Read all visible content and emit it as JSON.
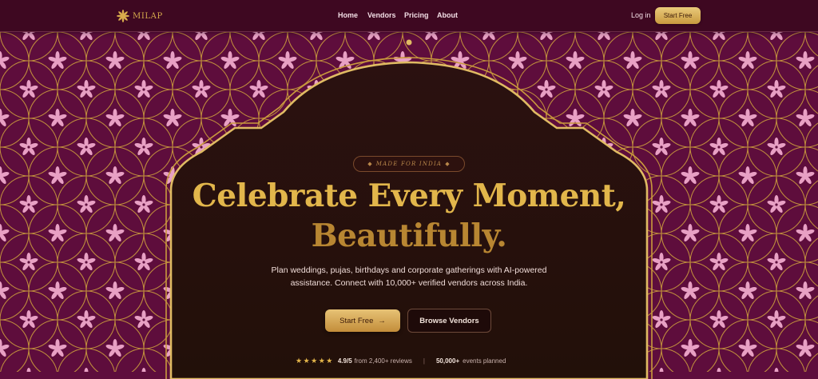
{
  "brand": {
    "name": "MILAP",
    "icon": "sparkle-icon"
  },
  "nav": {
    "links": [
      "Home",
      "Vendors",
      "Pricing",
      "About"
    ],
    "login": "Log in",
    "cta": "Start Free"
  },
  "hero": {
    "badge": "MADE FOR INDIA",
    "headline_line1": "Celebrate Every Moment,",
    "headline_line2": "Beautifully.",
    "subtext": "Plan weddings, pujas, birthdays and corporate gatherings with AI-powered assistance. Connect with 10,000+ verified vendors across India.",
    "primary_cta": "Start Free",
    "primary_cta_icon": "arrow-right-icon",
    "secondary_cta": "Browse Vendors"
  },
  "stats": {
    "stars": "★★★★★",
    "rating_value": "4.9/5",
    "rating_text": "from 2,400+ reviews",
    "separator": "|",
    "events_value": "50,000+",
    "events_text": "events planned"
  },
  "colors": {
    "background": "#5e0d3c",
    "gold": "#d9ac4c",
    "arch_fill": "#251010",
    "petal": "#e8a0c4"
  }
}
